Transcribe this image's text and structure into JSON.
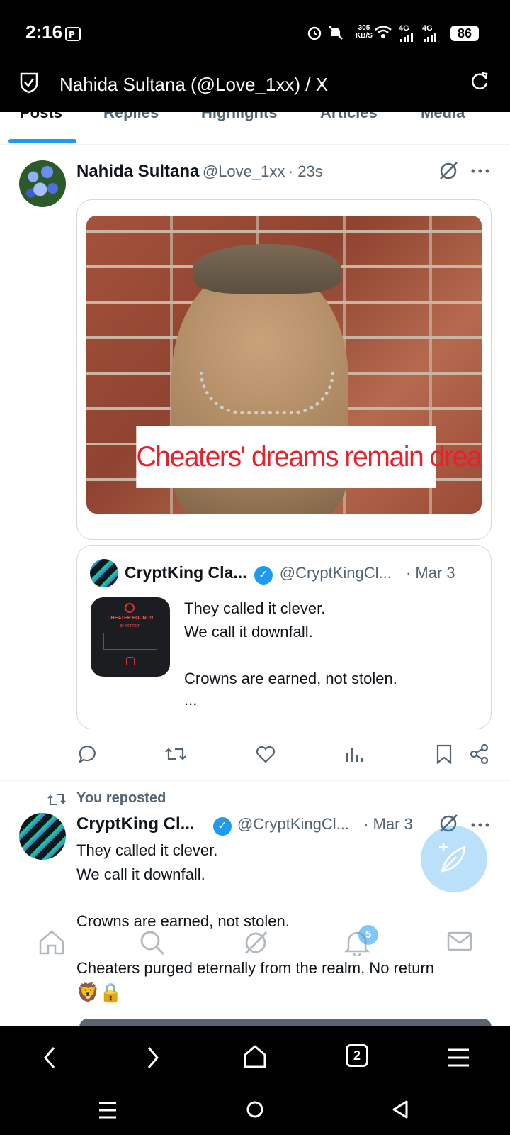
{
  "status_bar": {
    "time": "2:16",
    "speed_value": "305",
    "speed_unit": "KB/S",
    "net1": "4G",
    "net2": "4G",
    "battery": "86"
  },
  "browser": {
    "title": "Nahida Sultana (@Love_1xx) / X",
    "tab_count": "2"
  },
  "profile_tabs": [
    {
      "label": "Posts",
      "active": true
    },
    {
      "label": "Replies"
    },
    {
      "label": "Highlights"
    },
    {
      "label": "Articles"
    },
    {
      "label": "Media"
    }
  ],
  "post1": {
    "author": "Nahida Sultana",
    "handle": "@Love_1xx",
    "time": "· 23s",
    "image_caption": "Cheaters' dreams remain dreams.",
    "quote": {
      "author": "CryptKing Cla...",
      "handle": "@CryptKingCl...",
      "date": "· Mar 3",
      "thumb_title": "CHEATER FOUND!!",
      "thumb_sub": "ID # ERROR",
      "text_line1": "They called it clever.",
      "text_line2": "We call it downfall.",
      "text_line3": "Crowns are earned, not stolen.",
      "text_more": "..."
    }
  },
  "post2": {
    "repost_label": "You reposted",
    "author": "CryptKing Cl...",
    "handle": "@CryptKingCl...",
    "date": "· Mar 3",
    "line1": "They called it clever.",
    "line2": "We call it downfall.",
    "line3": "Crowns are earned, not stolen.",
    "line4": "Cheaters purged eternally from the realm, No return",
    "emojis": "🦁🔒"
  },
  "bottom_nav": {
    "notifications_badge": "5"
  },
  "colors": {
    "accent": "#1d9bf0",
    "text": "#0f1419",
    "muted": "#536471",
    "caption_red": "#e8202a"
  }
}
